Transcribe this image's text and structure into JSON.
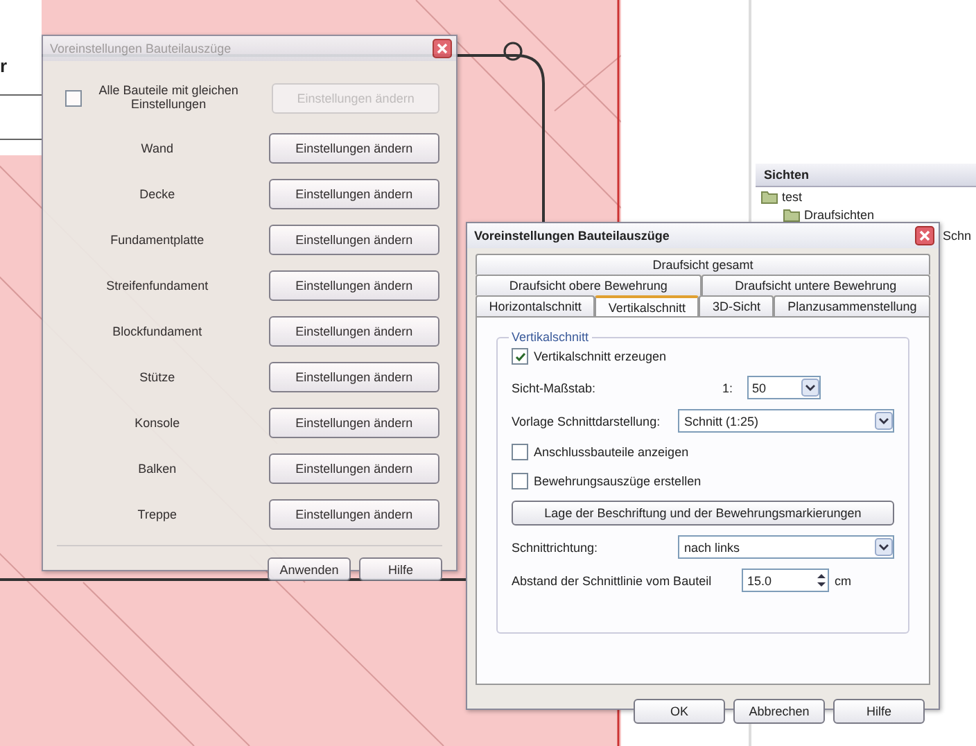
{
  "side_strip": {
    "text": "r"
  },
  "views_panel": {
    "title": "Sichten",
    "tree": [
      {
        "label": "test",
        "children": [
          {
            "label": "Draufsichten"
          }
        ]
      }
    ]
  },
  "behind_text": "Schn",
  "component_dialog": {
    "title": "Voreinstellungen Bauteilauszüge",
    "all_same": {
      "label": "Alle Bauteile mit gleichen Einstellungen",
      "checked": false
    },
    "all_button": {
      "label": "Einstellungen ändern",
      "disabled": true
    },
    "rows": [
      {
        "label": "Wand",
        "button": "Einstellungen ändern"
      },
      {
        "label": "Decke",
        "button": "Einstellungen ändern"
      },
      {
        "label": "Fundamentplatte",
        "button": "Einstellungen ändern"
      },
      {
        "label": "Streifenfundament",
        "button": "Einstellungen ändern"
      },
      {
        "label": "Blockfundament",
        "button": "Einstellungen ändern"
      },
      {
        "label": "Stütze",
        "button": "Einstellungen ändern"
      },
      {
        "label": "Konsole",
        "button": "Einstellungen ändern"
      },
      {
        "label": "Balken",
        "button": "Einstellungen ändern"
      },
      {
        "label": "Treppe",
        "button": "Einstellungen ändern"
      }
    ],
    "buttons": [
      "Anwenden",
      "Hilfe"
    ]
  },
  "section_dialog": {
    "title": "Voreinstellungen Bauteilauszüge",
    "tab_rows": [
      [
        {
          "label": "Draufsicht gesamt",
          "selected": false
        }
      ],
      [
        {
          "label": "Draufsicht obere Bewehrung",
          "selected": false
        },
        {
          "label": "Draufsicht untere Bewehrung",
          "selected": false
        }
      ],
      [
        {
          "label": "Horizontalschnitt",
          "selected": false
        },
        {
          "label": "Vertikalschnitt",
          "selected": true
        },
        {
          "label": "3D-Sicht",
          "selected": false
        },
        {
          "label": "Planzusammenstellung",
          "selected": false
        }
      ]
    ],
    "group_title": "Vertikalschnitt",
    "controls": [
      {
        "kind": "checkbox",
        "label": "Vertikalschnitt erzeugen",
        "checked": true
      },
      {
        "kind": "scale",
        "label": "Sicht-Maßstab:",
        "prefix": "1:",
        "value": "50"
      },
      {
        "kind": "select",
        "label": "Vorlage Schnittdarstellung:",
        "value": "Schnitt (1:25)"
      },
      {
        "kind": "checkbox",
        "label": "Anschlussbauteile anzeigen",
        "checked": false
      },
      {
        "kind": "checkbox",
        "label": "Bewehrungsauszüge erstellen",
        "checked": false
      },
      {
        "kind": "button",
        "label": "Lage der Beschriftung und der Bewehrungsmarkierungen"
      },
      {
        "kind": "select",
        "label": "Schnittrichtung:",
        "value": "nach links"
      },
      {
        "kind": "spin",
        "label": "Abstand der Schnittlinie vom Bauteil",
        "value": "15.0",
        "unit": "cm"
      }
    ],
    "buttons": [
      "OK",
      "Abbrechen",
      "Hilfe"
    ]
  }
}
